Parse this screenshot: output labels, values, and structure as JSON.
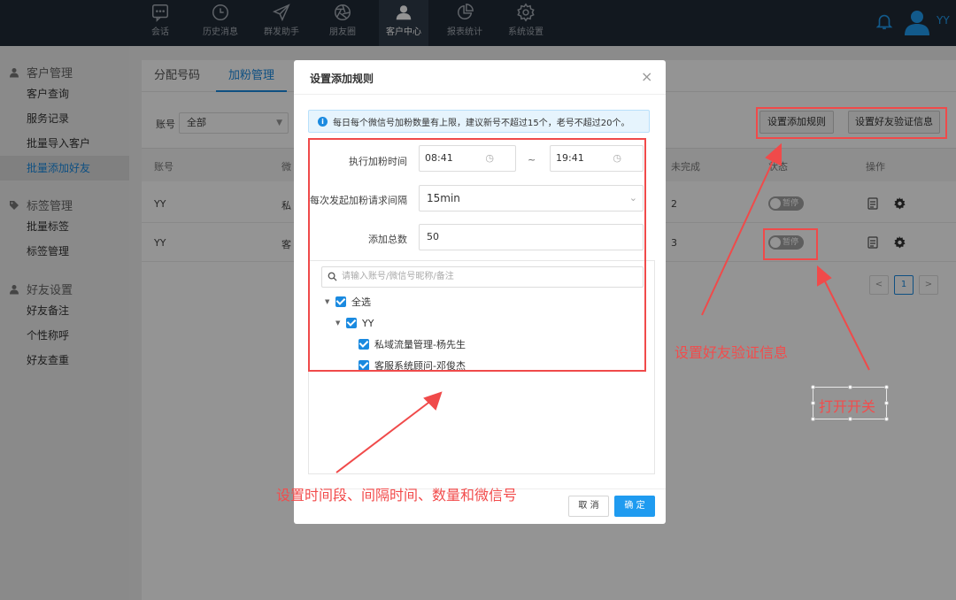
{
  "nav": {
    "items": [
      {
        "label": "会话",
        "icon": "chat-icon"
      },
      {
        "label": "历史消息",
        "icon": "clock-icon"
      },
      {
        "label": "群发助手",
        "icon": "send-icon"
      },
      {
        "label": "朋友圈",
        "icon": "aperture-icon"
      },
      {
        "label": "客户中心",
        "icon": "user-icon"
      },
      {
        "label": "报表统计",
        "icon": "pie-chart-icon"
      },
      {
        "label": "系统设置",
        "icon": "gear-icon"
      }
    ],
    "active_index": 4,
    "username": "YY"
  },
  "sidebar": {
    "sections": [
      {
        "title": "客户管理",
        "items": [
          "客户查询",
          "服务记录",
          "批量导入客户",
          "批量添加好友"
        ]
      },
      {
        "title": "标签管理",
        "items": [
          "批量标签",
          "标签管理"
        ]
      },
      {
        "title": "好友设置",
        "items": [
          "好友备注",
          "个性称呼",
          "好友查重"
        ]
      }
    ],
    "active_item": "批量添加好友"
  },
  "main": {
    "tabs": [
      "分配号码",
      "加粉管理"
    ],
    "active_tab": "加粉管理",
    "filter": {
      "label": "账号",
      "value": "全部"
    },
    "buttons": {
      "add_rule": "设置添加规则",
      "verify_msg": "设置好友验证信息"
    },
    "columns": [
      "账号",
      "微",
      "未完成",
      "状态",
      "操作"
    ],
    "rows": [
      {
        "account": "YY",
        "wechat": "私",
        "pending": "2",
        "status": "暂停"
      },
      {
        "account": "YY",
        "wechat": "客",
        "pending": "3",
        "status": "暂停"
      }
    ],
    "pagination": {
      "prev": "<",
      "current": "1",
      "next": ">"
    }
  },
  "modal": {
    "title": "设置添加规则",
    "close": "×",
    "notice": "每日每个微信号加粉数量有上限，建议新号不超过15个，老号不超过20个。",
    "time_label": "执行加粉时间",
    "time_start": "08:41",
    "time_sep": "~",
    "time_end": "19:41",
    "interval_label": "每次发起加粉请求间隔",
    "interval_value": "15min",
    "total_label": "添加总数",
    "total_value": "50",
    "search_placeholder": "请输入账号/微信号昵称/备注",
    "tree": {
      "select_all": "全选",
      "account": "YY",
      "children": [
        "私域流量管理-杨先生",
        "客服系统顾问-邓俊杰"
      ]
    },
    "cancel": "取 消",
    "confirm": "确 定"
  },
  "annotations": {
    "verify": "设置好友验证信息",
    "switch": "打开开关",
    "fields": "设置时间段、间隔时间、数量和微信号"
  },
  "colors": {
    "accent": "#1a8ae0",
    "annotation": "#f04a4a",
    "topbar": "#202a36"
  }
}
